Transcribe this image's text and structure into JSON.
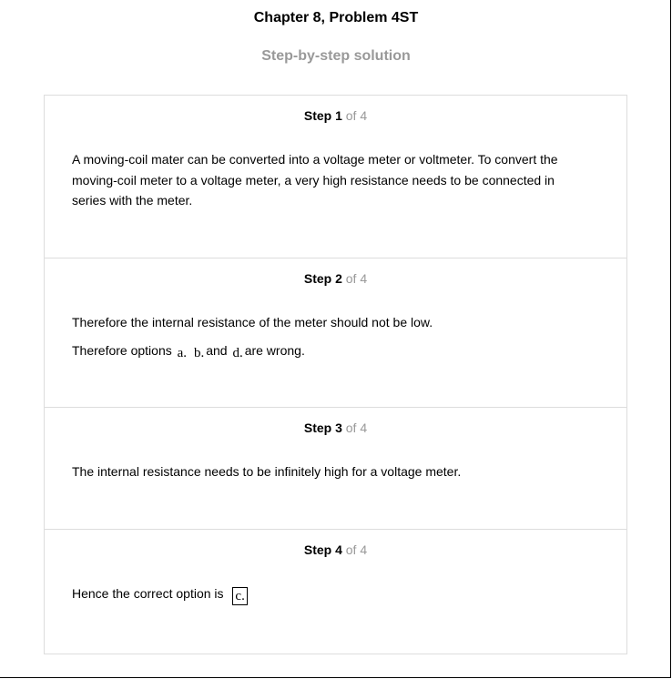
{
  "header": {
    "title": "Chapter 8, Problem 4ST",
    "subtitle": "Step-by-step solution"
  },
  "steps": [
    {
      "label": "Step 1",
      "of": "of 4",
      "text": "A moving-coil mater can be converted into a voltage meter or voltmeter. To convert the moving-coil meter to a voltage meter, a very high resistance needs to be connected in series with the meter."
    },
    {
      "label": "Step 2",
      "of": "of 4",
      "line1": "Therefore the internal resistance of the meter should not be low.",
      "line2_prefix": "Therefore options",
      "opt_a": "a.",
      "opt_b": "b.",
      "and": "and",
      "opt_d": "d.",
      "line2_suffix": "are wrong."
    },
    {
      "label": "Step 3",
      "of": "of 4",
      "text": "The internal resistance needs to be infinitely high for a voltage meter."
    },
    {
      "label": "Step 4",
      "of": "of 4",
      "text_prefix": "Hence the correct option is",
      "answer": "c."
    }
  ]
}
